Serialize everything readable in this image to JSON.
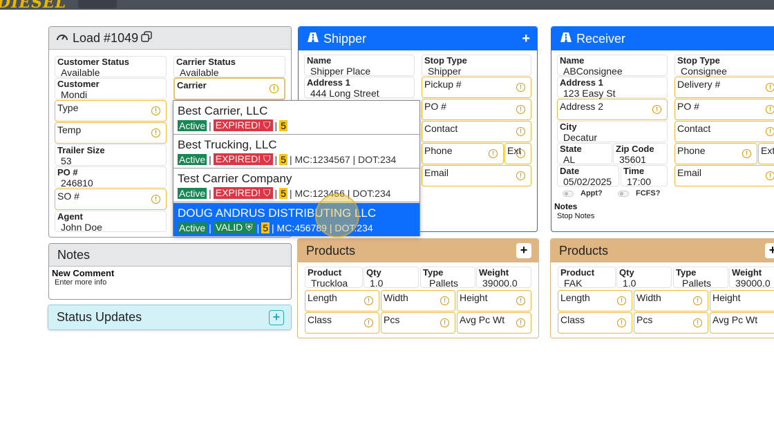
{
  "app": {
    "logo_text": "DIESEL"
  },
  "load": {
    "title": "Load #1049",
    "customer_status_label": "Customer Status",
    "customer_status": "Available",
    "carrier_status_label": "Carrier Status",
    "carrier_status": "Available",
    "customer_label": "Customer",
    "customer": "Mondi",
    "carrier_label": "Carrier",
    "carrier_value": "",
    "type_label": "Type",
    "temp_label": "Temp",
    "trailer_size_label": "Trailer Size",
    "trailer_size": "53",
    "po_label": "PO #",
    "po": "246810",
    "so_label": "SO #",
    "agent_label": "Agent",
    "agent": "John Doe"
  },
  "carrier_options": [
    {
      "name": "Best Carrier, LLC",
      "status": "Active",
      "sep1": "|",
      "authority": "EXPIRED!",
      "sep2": "|",
      "rating": "5",
      "extra": ""
    },
    {
      "name": "Best Trucking, LLC",
      "status": "Active",
      "sep1": "|",
      "authority": "EXPIRED!",
      "sep2": "|",
      "rating": "5",
      "extra": "| MC:1234567 | DOT:234"
    },
    {
      "name": "Test Carrier Company",
      "status": "Active",
      "sep1": "|",
      "authority": "EXPIRED!",
      "sep2": "|",
      "rating": "5",
      "extra": "| MC:123456 | DOT:234"
    },
    {
      "name": "DOUG ANDRUS DISTRIBUTING LLC",
      "status": "Active",
      "sep1": "|",
      "authority": "VALID",
      "sep2": "|",
      "rating": "5",
      "extra": "| MC:456789 | DOT:234"
    }
  ],
  "notes": {
    "title": "Notes",
    "new_comment_label": "New Comment",
    "placeholder": "Enter more info"
  },
  "status_updates": {
    "title": "Status Updates",
    "add": "+"
  },
  "shipper": {
    "title": "Shipper",
    "add": "+",
    "name_label": "Name",
    "name": "Shipper Place",
    "stop_type_label": "Stop Type",
    "stop_type": "Shipper",
    "address1_label": "Address 1",
    "address1": "444 Long Street",
    "pickup_label": "Pickup #",
    "po_label": "PO #",
    "contact_label": "Contact",
    "phone_label": "Phone",
    "ext_label": "Ext",
    "email_label": "Email"
  },
  "receiver": {
    "title": "Receiver",
    "name_label": "Name",
    "name": "ABConsignee",
    "stop_type_label": "Stop Type",
    "stop_type": "Consignee",
    "address1_label": "Address 1",
    "address1": "123 Easy St",
    "address2_label": "Address 2",
    "delivery_label": "Delivery #",
    "po_label": "PO #",
    "city_label": "City",
    "city": "Decatur",
    "contact_label": "Contact",
    "state_label": "State",
    "state": "AL",
    "zip_label": "Zip Code",
    "zip": "35601",
    "phone_label": "Phone",
    "ext_label": "Ext",
    "date_label": "Date",
    "date": "05/02/2025",
    "time_label": "Time",
    "time": "17:00",
    "email_label": "Email",
    "appt_label": "Appt?",
    "fcfs_label": "FCFS?",
    "notes_label": "Notes",
    "notes": "Stop Notes"
  },
  "products_shipper": {
    "title": "Products",
    "add": "+",
    "product_label": "Product",
    "product": "Truckloa",
    "qty_label": "Qty",
    "qty": "1.0",
    "type_label": "Type",
    "type": "Pallets",
    "weight_label": "Weight",
    "weight": "39000.0",
    "length_label": "Length",
    "width_label": "Width",
    "height_label": "Height",
    "class_label": "Class",
    "pcs_label": "Pcs",
    "avg_label": "Avg Pc Wt"
  },
  "products_receiver": {
    "title": "Products",
    "add": "+",
    "product_label": "Product",
    "product": "FAK",
    "qty_label": "Qty",
    "qty": "1.0",
    "type_label": "Type",
    "type": "Pallets",
    "weight_label": "Weight",
    "weight": "39000.0",
    "length_label": "Length",
    "width_label": "Width",
    "height_label": "Height",
    "class_label": "Class",
    "pcs_label": "Pcs",
    "avg_label": "Avg Pc Wt"
  },
  "colors": {
    "primary": "#0d6efd",
    "warning_border": "#f0b83c",
    "products_header": "#dfb581",
    "status_header": "#d3f2f8",
    "active_badge": "#198754",
    "expired_badge": "#dc3545"
  }
}
